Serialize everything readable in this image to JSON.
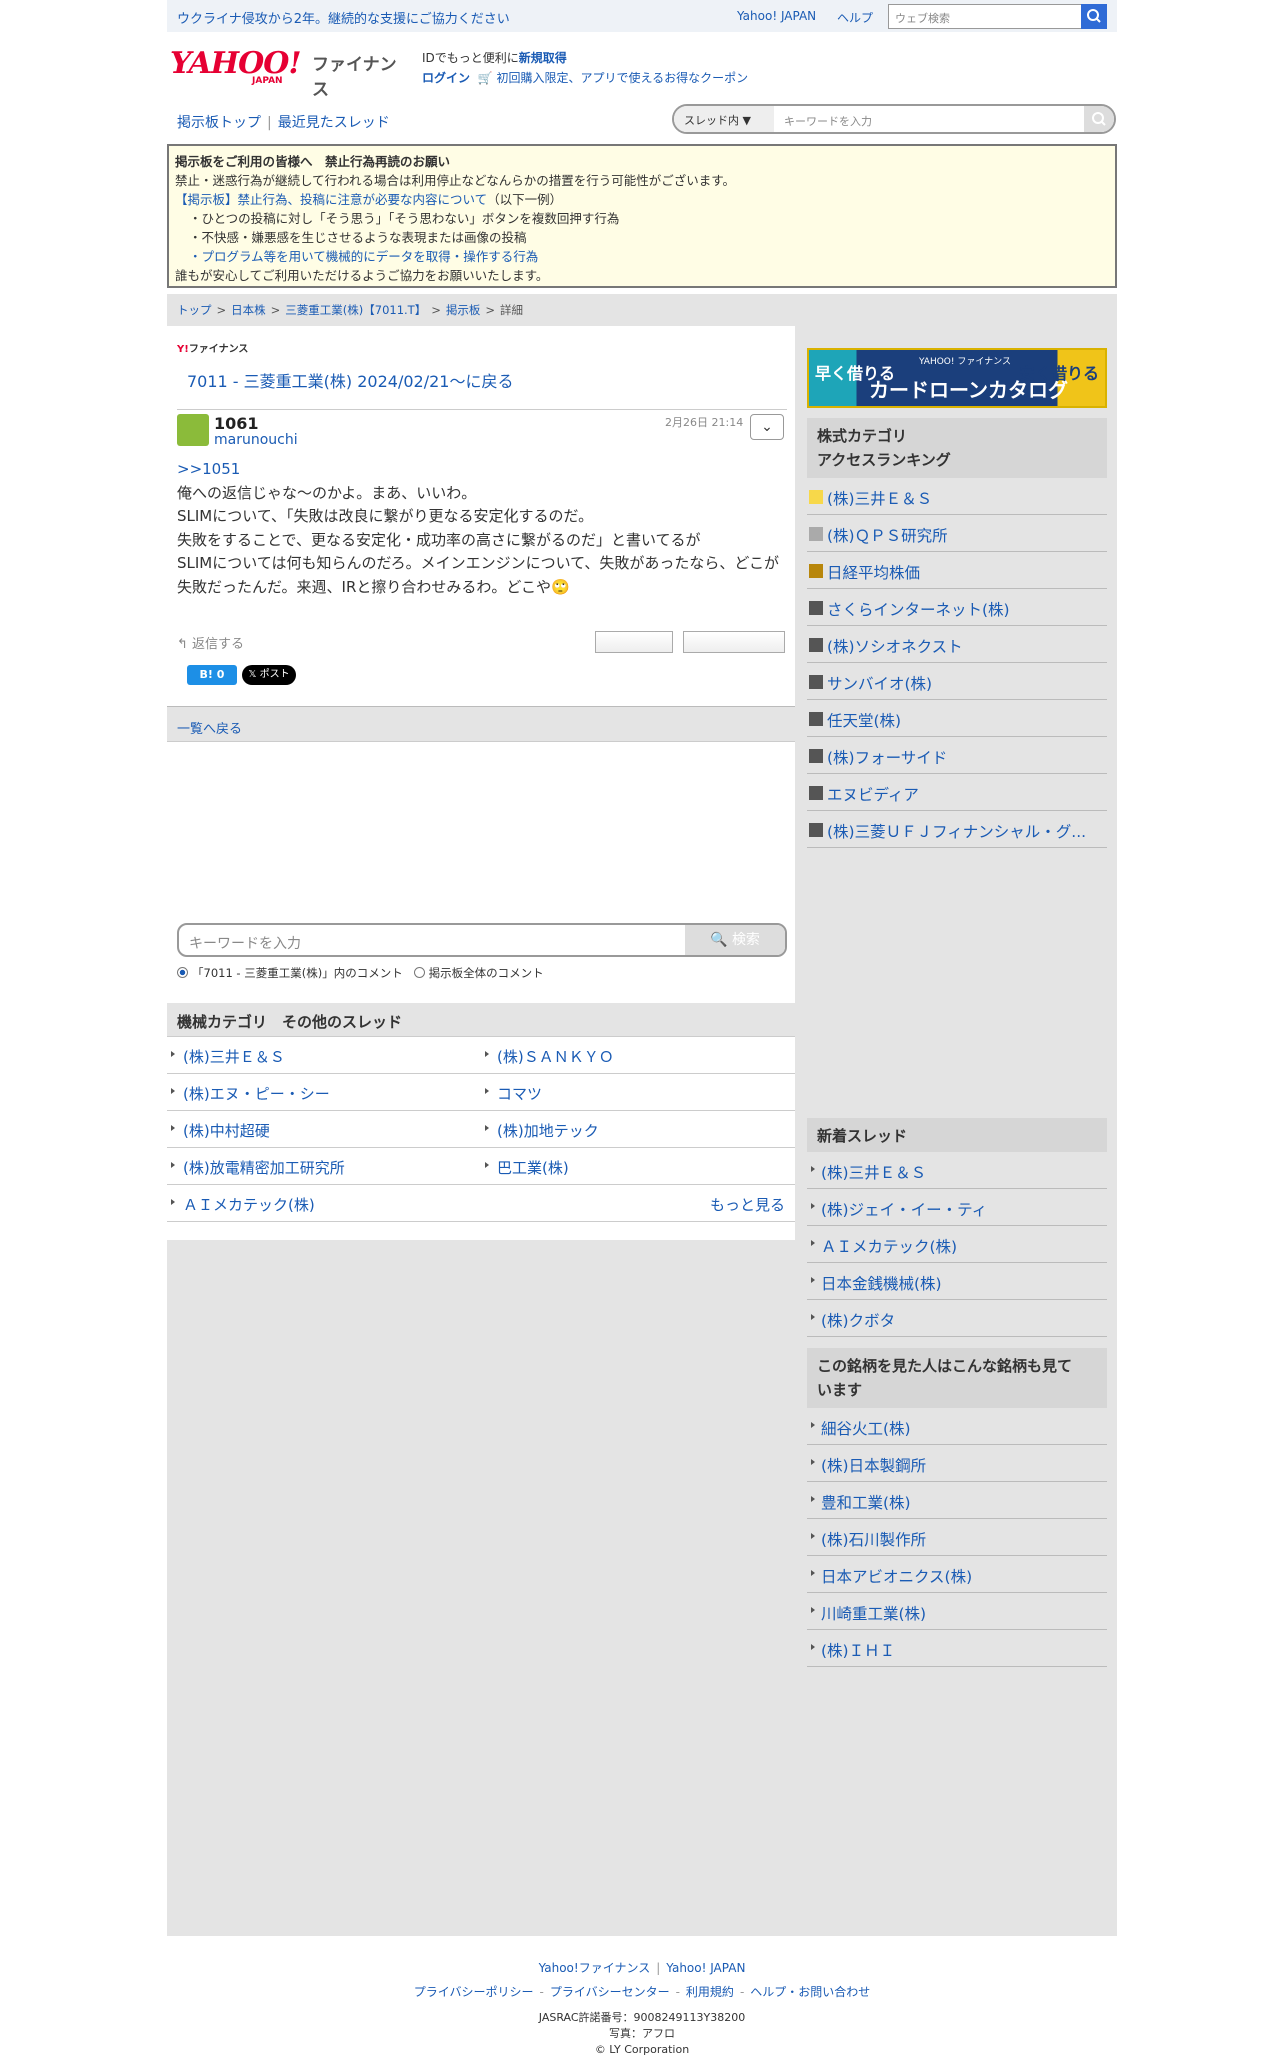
{
  "topbar": {
    "banner": "ウクライナ侵攻から2年。継続的な支援にご協力ください",
    "yahoo_japan": "Yahoo! JAPAN",
    "help": "ヘルプ",
    "search_placeholder": "ウェブ検索"
  },
  "header": {
    "logo": "YAHOO!",
    "logo_sub": "JAPAN",
    "logo_fin": "ファイナンス",
    "id_text": "IDでもっと便利に",
    "register": "新規取得",
    "login": "ログイン",
    "promo": "初回購入限定、アプリで使えるお得なクーポン"
  },
  "nav": {
    "board_top": "掲示板トップ",
    "recent": "最近見たスレッド",
    "scope": "スレッド内",
    "keyword_placeholder": "キーワードを入力"
  },
  "notice": {
    "title": "掲示板をご利用の皆様へ　禁止行為再読のお願い",
    "line1": "禁止・迷惑行為が継続して行われる場合は利用停止などなんらかの措置を行う可能性がございます。",
    "link": "【掲示板】禁止行為、投稿に注意が必要な内容について",
    "link_suffix": "（以下一例）",
    "item1": "・ひとつの投稿に対し「そう思う」「そう思わない」ボタンを複数回押す行為",
    "item2": "・不快感・嫌悪感を生じさせるような表現または画像の投稿",
    "item3": "・プログラム等を用いて機械的にデータを取得・操作する行為",
    "closing": "誰もが安心してご利用いただけるようご協力をお願いいたします。"
  },
  "breadcrumb": {
    "top": "トップ",
    "jp_stock": "日本株",
    "company": "三菱重工業(株)【7011.T】",
    "board": "掲示板",
    "detail": "詳細"
  },
  "thread": {
    "mini_logo": "ファイナンス",
    "back_title": "7011 - 三菱重工業(株) 2024/02/21〜に戻る"
  },
  "post": {
    "number": "1061",
    "user": "marunouchi",
    "date": "2月26日 21:14",
    "anchor": ">>1051",
    "line1": "俺への返信じゃな〜のかよ。まあ、いいわ。",
    "line2": "SLIMについて、「失敗は改良に繋がり更なる安定化するのだ。",
    "line3": "失敗をすることで、更なる安定化・成功率の高さに繋がるのだ」と書いてるが",
    "line4": "SLIMについては何も知らんのだろ。メインエンジンについて、失敗があったなら、どこが失敗だったんだ。来週、IRと擦り合わせみるわ。どこや🙄",
    "reply": "返信する",
    "hatena": "B! 0",
    "x_post": "ポスト"
  },
  "back_list": "一覧へ戻る",
  "keyword_search": {
    "placeholder": "キーワードを入力",
    "button": "検索",
    "radio1": "「7011 - 三菱重工業(株)」内のコメント",
    "radio2": "掲示板全体のコメント"
  },
  "category": {
    "title": "機械カテゴリ　その他のスレッド",
    "rows": [
      [
        "(株)三井Ｅ＆Ｓ",
        "(株)ＳＡＮＫＹＯ"
      ],
      [
        "(株)エヌ・ピー・シー",
        "コマツ"
      ],
      [
        "(株)中村超硬",
        "(株)加地テック"
      ],
      [
        "(株)放電精密加工研究所",
        "巴工業(株)"
      ],
      [
        "ＡＩメカテック(株)",
        ""
      ]
    ],
    "more": "もっと見る"
  },
  "ad": {
    "left": "早く借りる",
    "right": "安く借りる",
    "main": "カードローンカタログ",
    "brand": "YAHOO! ファイナンス"
  },
  "ranking": {
    "title_line1": "株式カテゴリ",
    "title_line2": "アクセスランキング",
    "items": [
      {
        "name": "(株)三井Ｅ＆Ｓ",
        "color": "#f7d84a"
      },
      {
        "name": "(株)ＱＰＳ研究所",
        "color": "#aaaaaa"
      },
      {
        "name": "日経平均株価",
        "color": "#b8860b"
      },
      {
        "name": "さくらインターネット(株)",
        "color": "#555555"
      },
      {
        "name": "(株)ソシオネクスト",
        "color": "#555555"
      },
      {
        "name": "サンバイオ(株)",
        "color": "#555555"
      },
      {
        "name": "任天堂(株)",
        "color": "#555555"
      },
      {
        "name": "(株)フォーサイド",
        "color": "#555555"
      },
      {
        "name": "エヌビディア",
        "color": "#555555"
      },
      {
        "name": "(株)三菱ＵＦＪフィナンシャル・グ...",
        "color": "#555555"
      }
    ]
  },
  "new_threads": {
    "title": "新着スレッド",
    "items": [
      "(株)三井Ｅ＆Ｓ",
      "(株)ジェイ・イー・ティ",
      "ＡＩメカテック(株)",
      "日本金銭機械(株)",
      "(株)クボタ"
    ]
  },
  "also_viewed": {
    "title_line1": "この銘柄を見た人はこんな銘柄も見て",
    "title_line2": "います",
    "items": [
      "細谷火工(株)",
      "(株)日本製鋼所",
      "豊和工業(株)",
      "(株)石川製作所",
      "日本アビオニクス(株)",
      "川崎重工業(株)",
      "(株)ＩＨＩ"
    ]
  },
  "footer": {
    "yf": "Yahoo!ファイナンス",
    "yj": "Yahoo! JAPAN",
    "privacy_policy": "プライバシーポリシー",
    "privacy_center": "プライバシーセンター",
    "terms": "利用規約",
    "help": "ヘルプ・お問い合わせ",
    "jasrac": "JASRAC許諾番号：9008249113Y38200",
    "photo": "写真：アフロ",
    "copyright": "© LY Corporation"
  }
}
